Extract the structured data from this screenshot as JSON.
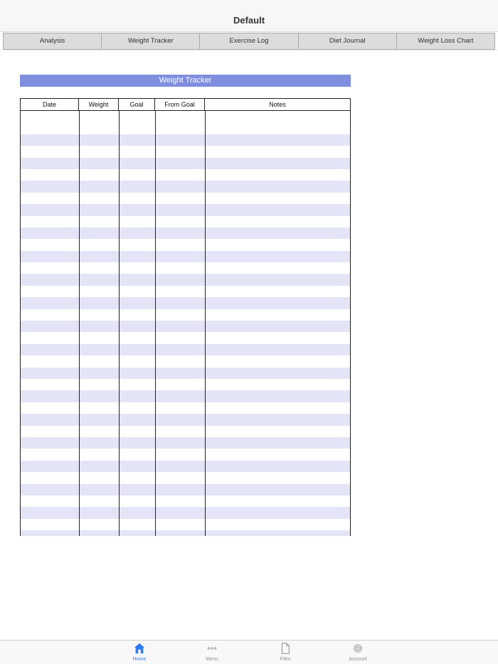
{
  "header": {
    "title": "Default"
  },
  "tabs": [
    {
      "label": "Analysis"
    },
    {
      "label": "Weight Tracker"
    },
    {
      "label": "Exercise Log"
    },
    {
      "label": "Diet Journal"
    },
    {
      "label": "Weight Loss Chart"
    }
  ],
  "sheet": {
    "title": "Weight Tracker",
    "columns": [
      "Date",
      "Weight",
      "Goal",
      "From Goal",
      "Notes"
    ],
    "rows": [],
    "colors": {
      "header_bg": "#7f8ede",
      "stripe": "#e3e5f6"
    }
  },
  "tabbar": {
    "items": [
      {
        "label": "Home",
        "icon": "home-icon",
        "active": true
      },
      {
        "label": "Menu",
        "icon": "more-icon",
        "active": false
      },
      {
        "label": "Files",
        "icon": "file-icon",
        "active": false
      },
      {
        "label": "Account",
        "icon": "gear-icon",
        "active": false
      }
    ],
    "accent": "#2f7cf6"
  }
}
